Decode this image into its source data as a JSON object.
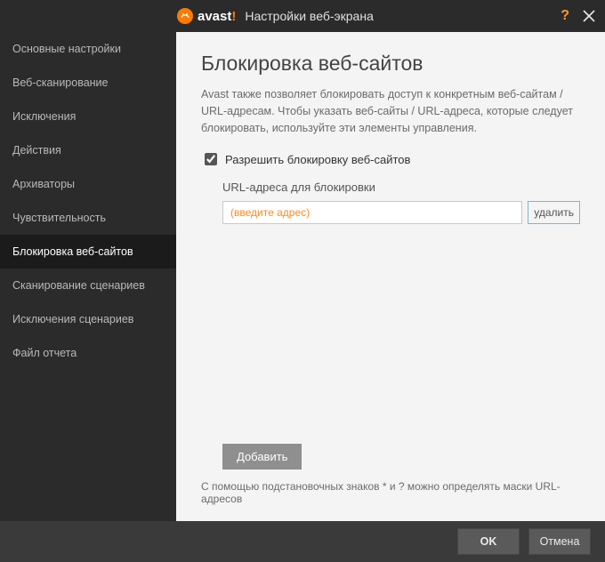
{
  "titlebar": {
    "logo_wordmark": "avast",
    "logo_bang": "!",
    "title": "Настройки веб-экрана",
    "help_label": "?",
    "close_label": "×"
  },
  "sidebar": {
    "items": [
      {
        "label": "Основные настройки"
      },
      {
        "label": "Веб-сканирование"
      },
      {
        "label": "Исключения"
      },
      {
        "label": "Действия"
      },
      {
        "label": "Архиваторы"
      },
      {
        "label": "Чувствительность"
      },
      {
        "label": "Блокировка веб-сайтов"
      },
      {
        "label": "Сканирование сценариев"
      },
      {
        "label": "Исключения сценариев"
      },
      {
        "label": "Файл отчета"
      }
    ],
    "active_index": 6
  },
  "main": {
    "title": "Блокировка веб-сайтов",
    "description": "Avast также позволяет блокировать доступ к конкретным веб-сайтам / URL-адресам. Чтобы указать веб-сайты / URL-адреса, которые следует блокировать, используйте эти элементы управления.",
    "enable_label": "Разрешить блокировку веб-сайтов",
    "enable_checked": true,
    "section_label": "URL-адреса для блокировки",
    "url_placeholder": "(введите адрес)",
    "url_value": "",
    "delete_label": "удалить",
    "add_label": "Добавить",
    "hint": "С помощью подстановочных знаков * и ? можно определять маски URL-адресов"
  },
  "footer": {
    "ok_label": "OK",
    "cancel_label": "Отмена"
  }
}
